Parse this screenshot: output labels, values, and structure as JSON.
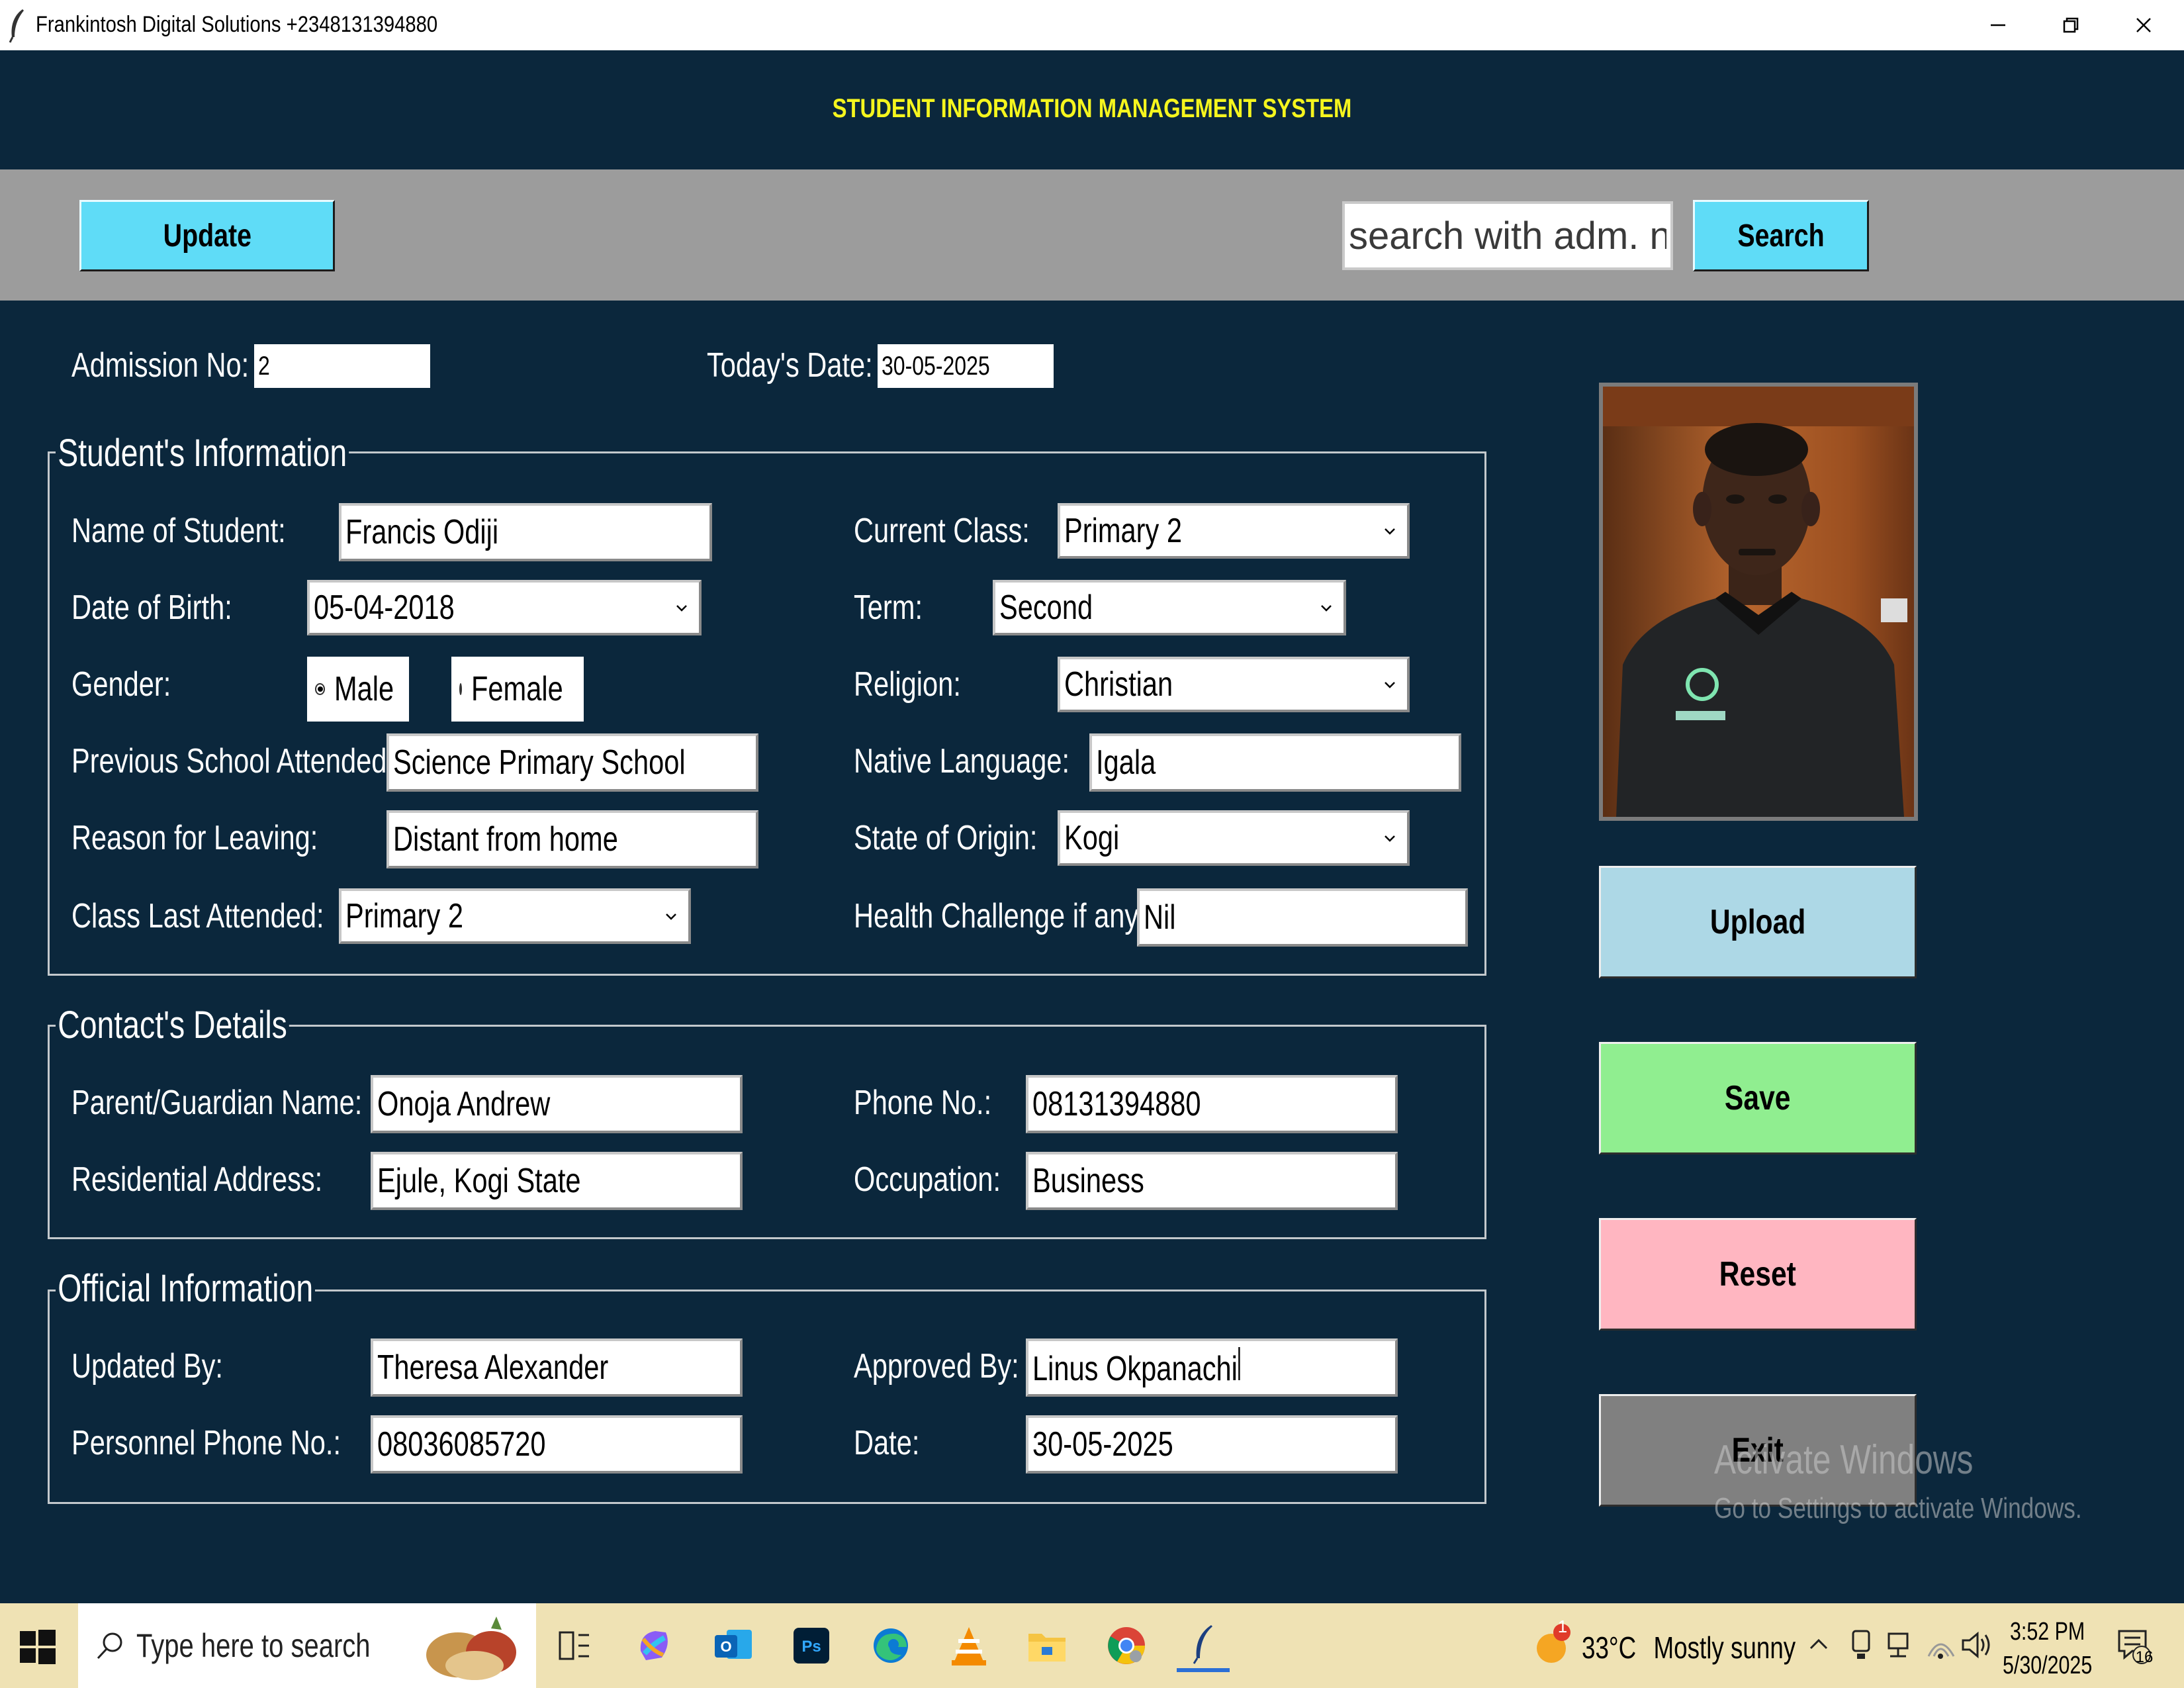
{
  "window": {
    "title": "Frankintosh Digital Solutions +2348131394880"
  },
  "header": {
    "title": "STUDENT INFORMATION MANAGEMENT SYSTEM"
  },
  "toolbar": {
    "update_label": "Update",
    "search_placeholder": "search with adm. no.",
    "search_value": "",
    "search_label": "Search"
  },
  "top": {
    "admission_label": "Admission No:",
    "admission_value": "2",
    "date_label": "Today's Date:",
    "date_value": "30-05-2025"
  },
  "student_info": {
    "title": "Student's Information",
    "name_label": "Name of Student:",
    "name_value": "Francis Odiji",
    "dob_label": "Date of Birth:",
    "dob_value": "05-04-2018",
    "gender_label": "Gender:",
    "gender_male": "Male",
    "gender_female": "Female",
    "gender_selected": "Male",
    "prev_school_label": "Previous School Attended:",
    "prev_school_value": "Science Primary School",
    "reason_label": "Reason for Leaving:",
    "reason_value": "Distant from home",
    "class_last_label": "Class Last Attended:",
    "class_last_value": "Primary 2",
    "current_class_label": "Current Class:",
    "current_class_value": "Primary 2",
    "term_label": "Term:",
    "term_value": "Second",
    "religion_label": "Religion:",
    "religion_value": "Christian",
    "native_lang_label": "Native Language:",
    "native_lang_value": "Igala",
    "state_label": "State of Origin:",
    "state_value": "Kogi",
    "health_label": "Health Challenge if any:",
    "health_value": "Nil"
  },
  "contact": {
    "title": "Contact's Details",
    "guardian_label": "Parent/Guardian Name:",
    "guardian_value": "Onoja Andrew",
    "address_label": "Residential Address:",
    "address_value": "Ejule, Kogi State",
    "phone_label": "Phone No.:",
    "phone_value": "08131394880",
    "occupation_label": "Occupation:",
    "occupation_value": "Business"
  },
  "official": {
    "title": "Official Information",
    "updated_by_label": "Updated By:",
    "updated_by_value": "Theresa Alexander",
    "personnel_phone_label": "Personnel Phone No.:",
    "personnel_phone_value": "08036085720",
    "approved_by_label": "Approved By:",
    "approved_by_value": "Linus Okpanachi",
    "date_label": "Date:",
    "date_value": "30-05-2025"
  },
  "buttons": {
    "upload": "Upload",
    "save": "Save",
    "reset": "Reset",
    "exit": "Exit"
  },
  "colors": {
    "background": "#0b273c",
    "title_yellow": "#f5f51e",
    "toolbar_gray": "#9c9c9c",
    "cyan_button": "#5fdcf7",
    "upload": "#add8e6",
    "save": "#90ee90",
    "reset": "#ffb6c1",
    "exit": "#808080"
  },
  "watermark": {
    "line1": "Activate Windows",
    "line2": "Go to Settings to activate Windows."
  },
  "taskbar": {
    "search_placeholder": "Type here to search",
    "weather_temp": "33°C",
    "weather_desc": "Mostly sunny",
    "time": "3:52 PM",
    "date": "5/30/2025",
    "notification_count": "16",
    "weather_badge": "1"
  }
}
